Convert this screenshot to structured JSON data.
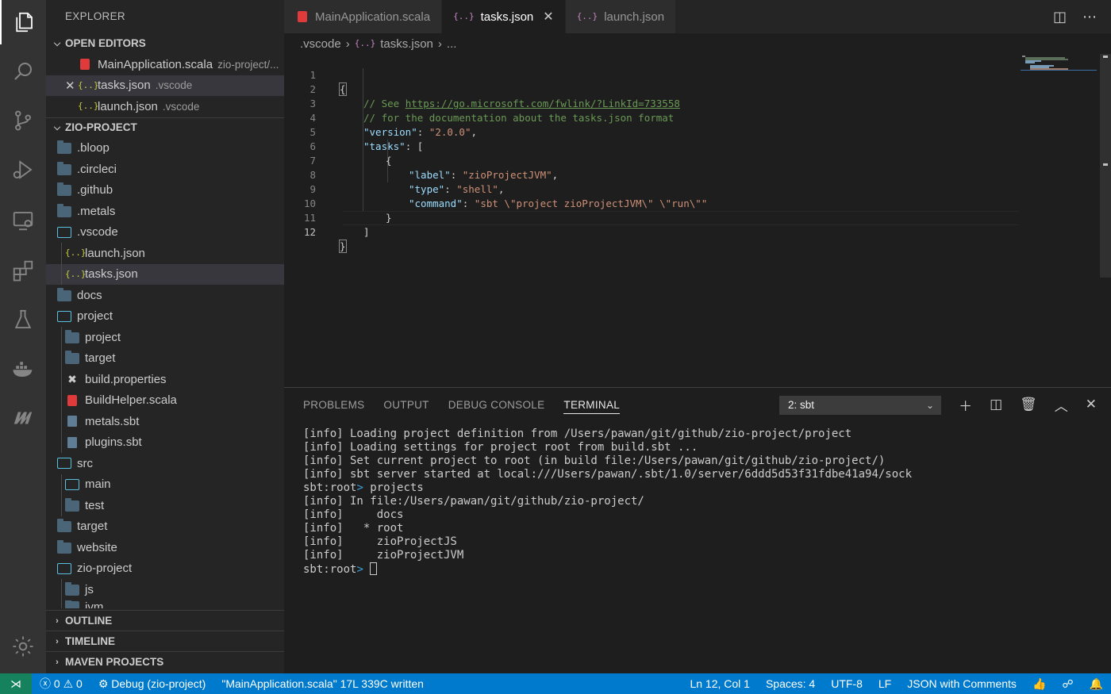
{
  "activity_bar": {
    "icons": [
      "files-icon",
      "search-icon",
      "source-control-icon",
      "run-debug-icon",
      "remote-explorer-icon",
      "extensions-icon",
      "testing-icon",
      "docker-icon",
      "metals-icon",
      "gear-icon"
    ]
  },
  "sidebar": {
    "title": "EXPLORER",
    "open_editors": {
      "label": "OPEN EDITORS",
      "items": [
        {
          "name": "MainApplication.scala",
          "desc": "zio-project/..."
        },
        {
          "name": "tasks.json",
          "desc": ".vscode"
        },
        {
          "name": "launch.json",
          "desc": ".vscode"
        }
      ]
    },
    "project": {
      "label": "ZIO-PROJECT",
      "items": [
        {
          "name": ".bloop"
        },
        {
          "name": ".circleci"
        },
        {
          "name": ".github"
        },
        {
          "name": ".metals"
        },
        {
          "name": ".vscode"
        },
        {
          "name": "launch.json"
        },
        {
          "name": "tasks.json"
        },
        {
          "name": "docs"
        },
        {
          "name": "project"
        },
        {
          "name": "project"
        },
        {
          "name": "target"
        },
        {
          "name": "build.properties"
        },
        {
          "name": "BuildHelper.scala"
        },
        {
          "name": "metals.sbt"
        },
        {
          "name": "plugins.sbt"
        },
        {
          "name": "src"
        },
        {
          "name": "main"
        },
        {
          "name": "test"
        },
        {
          "name": "target"
        },
        {
          "name": "website"
        },
        {
          "name": "zio-project"
        },
        {
          "name": "js"
        },
        {
          "name": "jvm"
        }
      ]
    },
    "outline_label": "OUTLINE",
    "timeline_label": "TIMELINE",
    "maven_label": "MAVEN PROJECTS"
  },
  "tabs": [
    {
      "label": "MainApplication.scala",
      "active": false
    },
    {
      "label": "tasks.json",
      "active": true
    },
    {
      "label": "launch.json",
      "active": false
    }
  ],
  "breadcrumb": {
    "folder": ".vscode",
    "file": "tasks.json",
    "more": "..."
  },
  "editor": {
    "line_numbers": [
      "1",
      "2",
      "3",
      "4",
      "5",
      "6",
      "7",
      "8",
      "9",
      "10",
      "11",
      "12"
    ],
    "comment1_prefix": "// See ",
    "comment1_link": "https://go.microsoft.com/fwlink/?LinkId=733558",
    "comment2": "// for the documentation about the tasks.json format",
    "version_key": "\"version\"",
    "version_val": "\"2.0.0\"",
    "tasks_key": "\"tasks\"",
    "label_key": "\"label\"",
    "label_val": "\"zioProjectJVM\"",
    "type_key": "\"type\"",
    "type_val": "\"shell\"",
    "command_key": "\"command\"",
    "command_val": "\"sbt \\\"project zioProjectJVM\\\" \\\"run\\\"\""
  },
  "panel": {
    "tabs": [
      "PROBLEMS",
      "OUTPUT",
      "DEBUG CONSOLE",
      "TERMINAL"
    ],
    "terminal_select": "2: sbt",
    "terminal_lines": [
      "[info] Loading project definition from /Users/pawan/git/github/zio-project/project",
      "[info] Loading settings for project root from build.sbt ...",
      "[info] Set current project to root (in build file:/Users/pawan/git/github/zio-project/)",
      "[info] sbt server started at local:///Users/pawan/.sbt/1.0/server/6ddd5d53f31fdbe41a94/sock"
    ],
    "prompt1_prefix": "sbt:root",
    "prompt1_cmd": " projects",
    "terminal_lines2": [
      "[info] In file:/Users/pawan/git/github/zio-project/",
      "[info]     docs",
      "[info]   * root",
      "[info]     zioProjectJS",
      "[info]     zioProjectJVM"
    ],
    "prompt2_prefix": "sbt:root"
  },
  "statusbar": {
    "errors": "0",
    "warnings": "0",
    "debug": "Debug (zio-project)",
    "message": "\"MainApplication.scala\" 17L 339C written",
    "position": "Ln 12, Col 1",
    "spaces": "Spaces: 4",
    "encoding": "UTF-8",
    "eol": "LF",
    "language": "JSON with Comments"
  },
  "colors": {
    "statusbar": "#007acc",
    "remote": "#16825d",
    "activity": "#333333",
    "sidebar": "#252526",
    "editor": "#1e1e1e"
  }
}
